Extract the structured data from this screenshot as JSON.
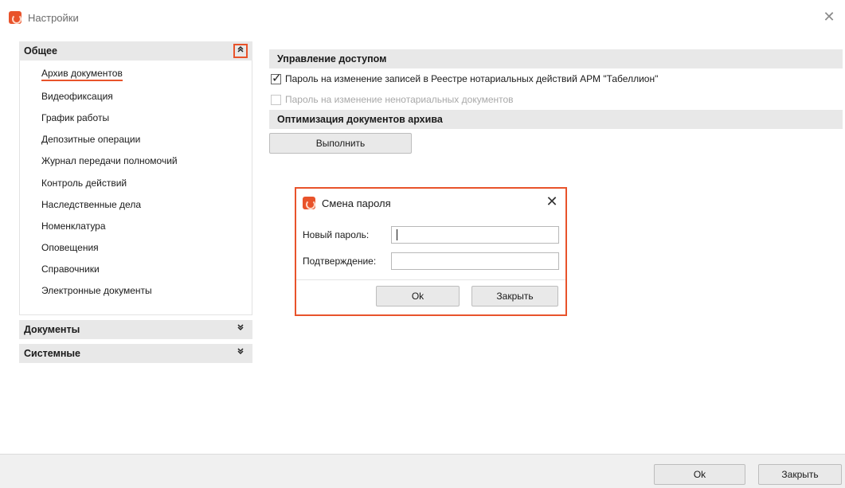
{
  "window": {
    "title": "Настройки"
  },
  "sidebar": {
    "general": {
      "label": "Общее",
      "items": [
        {
          "label": "Архив документов",
          "selected": true
        },
        {
          "label": "Видеофиксация"
        },
        {
          "label": "График работы"
        },
        {
          "label": "Депозитные операции"
        },
        {
          "label": "Журнал передачи полномочий"
        },
        {
          "label": "Контроль действий"
        },
        {
          "label": "Наследственные дела"
        },
        {
          "label": "Номенклатура"
        },
        {
          "label": "Оповещения"
        },
        {
          "label": "Справочники"
        },
        {
          "label": "Электронные документы"
        }
      ]
    },
    "documents": {
      "label": "Документы"
    },
    "system": {
      "label": "Системные"
    }
  },
  "main": {
    "access": {
      "header": "Управление доступом",
      "option1": {
        "label": "Пароль на изменение записей в Реестре нотариальных действий АРМ \"Табеллион\"",
        "checked": true
      },
      "option2": {
        "label": "Пароль на изменение ненотариальных документов",
        "checked": false,
        "disabled": true
      }
    },
    "optimization": {
      "header": "Оптимизация документов архива",
      "run_button": "Выполнить"
    }
  },
  "dialog": {
    "title": "Смена пароля",
    "new_password_label": "Новый пароль:",
    "new_password_value": "",
    "confirm_label": "Подтверждение:",
    "confirm_value": "",
    "ok_button": "Ok",
    "close_button": "Закрыть"
  },
  "footer": {
    "ok_button": "Ok",
    "close_button": "Закрыть"
  },
  "colors": {
    "accent": "#e8532b",
    "header_bg": "#e8e8e8"
  }
}
